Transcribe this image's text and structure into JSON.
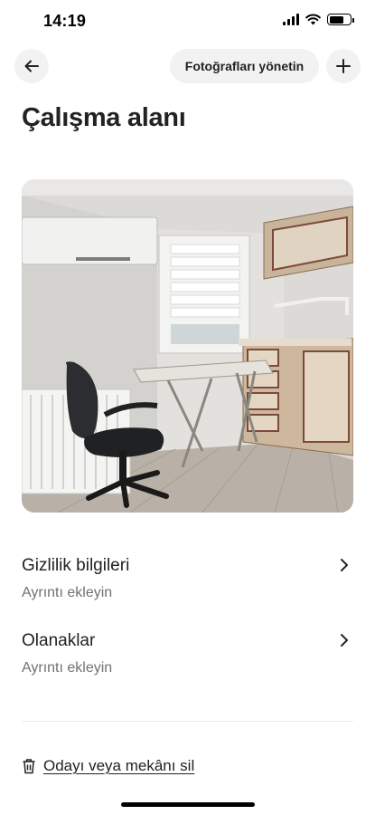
{
  "status_bar": {
    "time": "14:19",
    "battery_level": 0.72
  },
  "header": {
    "back_icon": "arrow-left-icon",
    "manage_photos_label": "Fotoğrafları yönetin",
    "add_icon": "plus-icon"
  },
  "page": {
    "title": "Çalışma alanı"
  },
  "photo": {
    "subject": "room-photo"
  },
  "sections": [
    {
      "title": "Gizlilik bilgileri",
      "subtitle": "Ayrıntı ekleyin",
      "icon": "chevron-right-icon"
    },
    {
      "title": "Olanaklar",
      "subtitle": "Ayrıntı ekleyin",
      "icon": "chevron-right-icon"
    }
  ],
  "delete": {
    "icon": "trash-icon",
    "label": "Odayı veya mekânı sil"
  }
}
